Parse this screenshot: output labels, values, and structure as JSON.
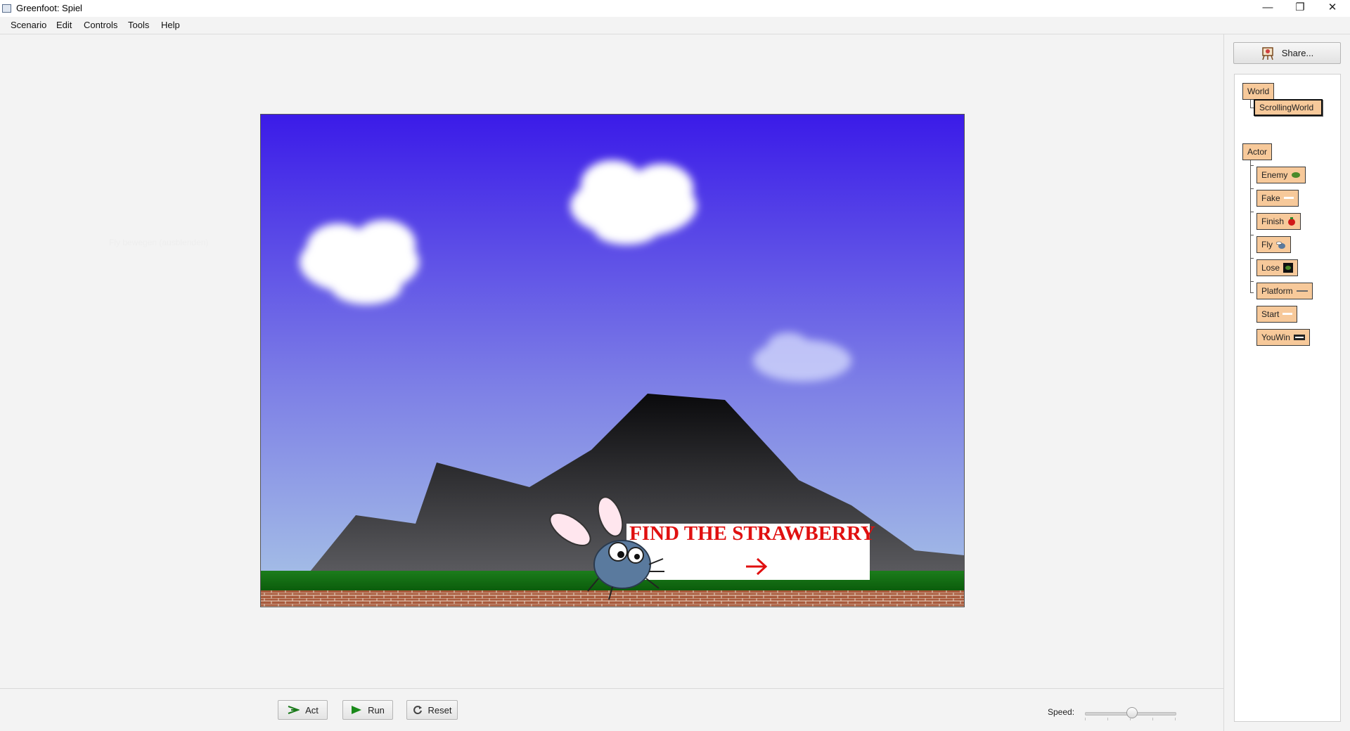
{
  "window": {
    "title": "Greenfoot: Spiel",
    "controls": [
      "—",
      "❐",
      "✕"
    ]
  },
  "menu": [
    "Scenario",
    "Edit",
    "Controls",
    "Tools",
    "Help"
  ],
  "world": {
    "banner_text": "FIND THE STRAWBERRY",
    "ghost_label": "Fly bewegen (ausblenden)"
  },
  "controls": {
    "act_label": "Act",
    "run_label": "Run",
    "reset_label": "Reset",
    "speed_label": "Speed:",
    "speed_value": 0.52
  },
  "sidebar": {
    "share_label": "Share...",
    "world_root": "World",
    "world_classes": [
      "ScrollingWorld"
    ],
    "actor_root": "Actor",
    "actor_classes": [
      "Enemy",
      "Fake",
      "Finish",
      "Fly",
      "Lose",
      "Platform",
      "Start",
      "YouWin"
    ]
  },
  "colors": {
    "class_box": "#f7c99a",
    "sky_top": "#3b1be8",
    "sky_bottom": "#a9c6e6",
    "banner_text": "#e01010"
  }
}
